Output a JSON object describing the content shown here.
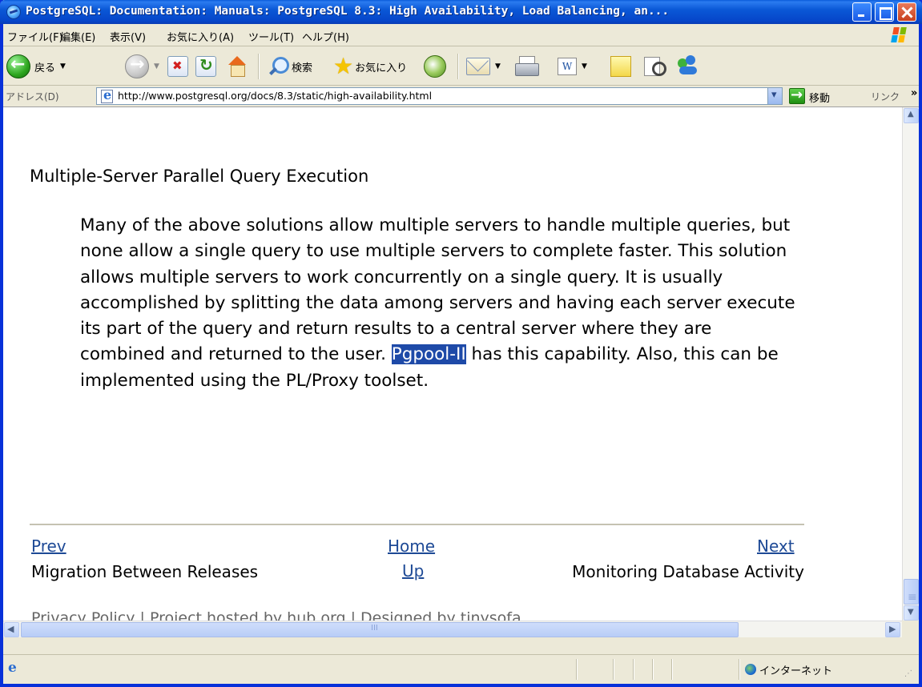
{
  "window": {
    "title": "PostgreSQL: Documentation: Manuals: PostgreSQL 8.3: High Availability, Load Balancing, an..."
  },
  "menu": [
    "ファイル(F)",
    "編集(E)",
    "表示(V)",
    "お気に入り(A)",
    "ツール(T)",
    "ヘルプ(H)"
  ],
  "toolbar": {
    "back_label": "戻る",
    "search_label": "検索",
    "favorites_label": "お気に入り"
  },
  "address": {
    "label": "アドレス(D)",
    "url": "http://www.postgresql.org/docs/8.3/static/high-availability.html",
    "go_label": "移動",
    "links_label": "リンク",
    "more": "»"
  },
  "page": {
    "section_title": "Multiple-Server Parallel Query Execution",
    "paragraph_before": "Many of the above solutions allow multiple servers to handle multiple queries, but none allow a single query to use multiple servers to complete faster. This solution allows multiple servers to work concurrently on a single query. It is usually accomplished by splitting the data among servers and having each server execute its part of the query and return results to a central server where they are combined and returned to the user. ",
    "paragraph_highlight": "Pgpool-II",
    "paragraph_after": " has this capability. Also, this can be implemented using the PL/Proxy toolset.",
    "nav": {
      "prev": "Prev",
      "home": "Home",
      "next": "Next",
      "up": "Up",
      "prev_title": "Migration Between Releases",
      "next_title": "Monitoring Database Activity"
    },
    "footer": {
      "privacy": "Privacy Policy",
      "sep1": " | Project hosted by ",
      "hub": "hub.org",
      "sep2": " | Designed by ",
      "designer": "tinysofa"
    }
  },
  "status": {
    "zone": "インターネット"
  },
  "colors": {
    "title_bar": "#0a58d6",
    "selection": "#1e4aa8",
    "link": "#1e4a96"
  }
}
